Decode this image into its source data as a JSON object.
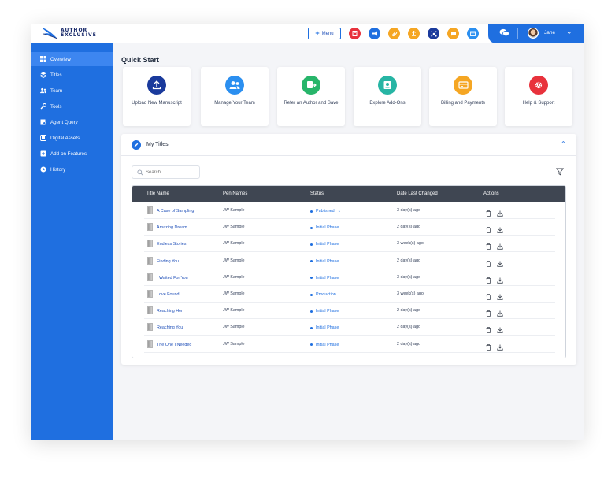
{
  "brand": {
    "line1": "AUTHOR",
    "line2": "EXCLUSIVE"
  },
  "header": {
    "menu_label": "Menu",
    "icons": [
      {
        "name": "manuscript-icon",
        "color": "#e8323c"
      },
      {
        "name": "megaphone-icon",
        "color": "#1f6fe0"
      },
      {
        "name": "link-icon",
        "color": "#f5a623"
      },
      {
        "name": "upload-icon",
        "color": "#f5a623"
      },
      {
        "name": "network-icon",
        "color": "#1a3a9c"
      },
      {
        "name": "chat-icon",
        "color": "#f5a623"
      },
      {
        "name": "calendar-icon",
        "color": "#2b8ff0"
      }
    ],
    "user_name": "Jane"
  },
  "sidebar": {
    "items": [
      {
        "label": "Overview",
        "icon": "grid-icon",
        "active": true
      },
      {
        "label": "Titles",
        "icon": "layers-icon"
      },
      {
        "label": "Team",
        "icon": "team-icon"
      },
      {
        "label": "Tools",
        "icon": "wrench-icon"
      },
      {
        "label": "Agent Query",
        "icon": "query-icon"
      },
      {
        "label": "Digital Assets",
        "icon": "assets-icon"
      },
      {
        "label": "Add-on Features",
        "icon": "addon-icon"
      },
      {
        "label": "History",
        "icon": "history-icon"
      }
    ]
  },
  "quick_start": {
    "title": "Quick Start",
    "cards": [
      {
        "label": "Upload New Manuscript",
        "icon": "upload-icon",
        "color": "#1a3a9c"
      },
      {
        "label": "Manage Your Team",
        "icon": "team-icon",
        "color": "#2b8ff0"
      },
      {
        "label": "Refer an Author and Save",
        "icon": "refer-icon",
        "color": "#27b56a"
      },
      {
        "label": "Explore Add-Ons",
        "icon": "explore-icon",
        "color": "#27b5a4"
      },
      {
        "label": "Billing and Payments",
        "icon": "billing-icon",
        "color": "#f5a623"
      },
      {
        "label": "Help & Support",
        "icon": "gear-icon",
        "color": "#e8323c"
      }
    ]
  },
  "my_titles": {
    "title": "My Titles",
    "search_placeholder": "Search",
    "columns": [
      "Title Name",
      "Pen Names",
      "Status",
      "Date Last Changed",
      "Actions"
    ],
    "rows": [
      {
        "title": "A Case of Sampling",
        "pen": "JW Sample",
        "status": "Published",
        "date": "3 day(s) ago"
      },
      {
        "title": "Amazing Dream",
        "pen": "JW Sample",
        "status": "Initial Phase",
        "date": "2 day(s) ago"
      },
      {
        "title": "Endless Stories",
        "pen": "JW Sample",
        "status": "Initial Phase",
        "date": "3 week(s) ago"
      },
      {
        "title": "Finding You",
        "pen": "JW Sample",
        "status": "Initial Phase",
        "date": "2 day(s) ago"
      },
      {
        "title": "I Waited For You",
        "pen": "JW Sample",
        "status": "Initial Phase",
        "date": "3 day(s) ago"
      },
      {
        "title": "Love Found",
        "pen": "JW Sample",
        "status": "Production",
        "date": "3 week(s) ago"
      },
      {
        "title": "Reaching Her",
        "pen": "JW Sample",
        "status": "Initial Phase",
        "date": "2 day(s) ago"
      },
      {
        "title": "Reaching You",
        "pen": "JW Sample",
        "status": "Initial Phase",
        "date": "2 day(s) ago"
      },
      {
        "title": "The One I Needed",
        "pen": "JW Sample",
        "status": "Initial Phase",
        "date": "2 day(s) ago"
      }
    ]
  }
}
